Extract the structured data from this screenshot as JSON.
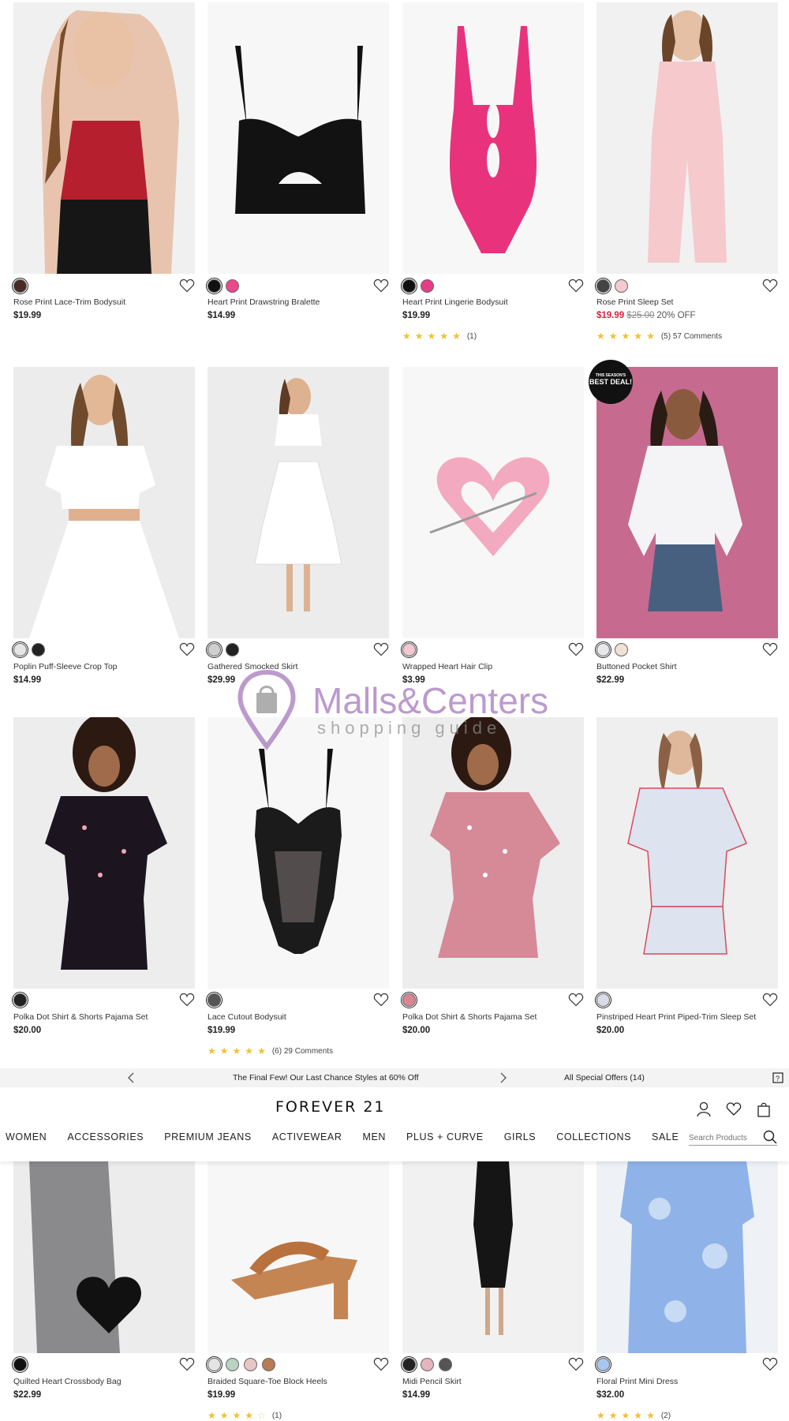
{
  "products": [
    {
      "name": "Rose Print Lace-Trim Bodysuit",
      "price": "$19.99",
      "swatches": [
        "#4a2a25"
      ],
      "img": "bodysuit-rose"
    },
    {
      "name": "Heart Print Drawstring Bralette",
      "price": "$14.99",
      "swatches": [
        "#111111",
        "#e9488a"
      ],
      "img": "bralette-black"
    },
    {
      "name": "Heart Print Lingerie Bodysuit",
      "price": "$19.99",
      "swatches": [
        "#111111",
        "#e63b86"
      ],
      "rating": "(1)",
      "stars": 5,
      "img": "bodysuit-pink"
    },
    {
      "name": "Rose Print Sleep Set",
      "price_sale": "$19.99",
      "price_orig": "$25.00",
      "price_off": "20% OFF",
      "swatches": [
        "#444444",
        "#f4c9cf"
      ],
      "rating": "(5) 57 Comments",
      "stars": 5,
      "img": "sleepset-rose"
    },
    {
      "name": "Poplin Puff-Sleeve Crop Top",
      "price": "$14.99",
      "swatches": [
        "#e5e5e5",
        "#222222"
      ],
      "img": "crop-white"
    },
    {
      "name": "Gathered Smocked Skirt",
      "price": "$29.99",
      "swatches": [
        "#cfcfcf",
        "#222222"
      ],
      "img": "skirt-white"
    },
    {
      "name": "Wrapped Heart Hair Clip",
      "price": "$3.99",
      "swatches": [
        "#f2c7cf"
      ],
      "img": "hairclip"
    },
    {
      "name": "Buttoned Pocket Shirt",
      "price": "$22.99",
      "swatches": [
        "#e8e8ec",
        "#efe1d4"
      ],
      "img": "shirt-white",
      "badge_top": "THIS SEASON'S",
      "badge_main": "BEST DEAL!"
    },
    {
      "name": "Polka Dot Shirt & Shorts Pajama Set",
      "price": "$20.00",
      "swatches": [
        "#222222"
      ],
      "img": "pj-black"
    },
    {
      "name": "Lace Cutout Bodysuit",
      "price": "$19.99",
      "swatches": [
        "#555555"
      ],
      "rating": "(6) 29 Comments",
      "stars": 4.5,
      "img": "lace-black"
    },
    {
      "name": "Polka Dot Shirt & Shorts Pajama Set",
      "price": "$20.00",
      "swatches": [
        "#d98592"
      ],
      "img": "pj-pink"
    },
    {
      "name": "Pinstriped Heart Print Piped-Trim Sleep Set",
      "price": "$20.00",
      "swatches": [
        "#d8dce6"
      ],
      "img": "pj-stripe"
    },
    {
      "name": "Quilted Heart Crossbody Bag",
      "price": "$22.99",
      "swatches": [
        "#111111"
      ],
      "img": "heartbag"
    },
    {
      "name": "Braided Square-Toe Block Heels",
      "price": "$19.99",
      "swatches": [
        "#e4e4e4",
        "#b9d2c2",
        "#e9c6c6",
        "#b97b55"
      ],
      "rating": "(1)",
      "stars": 4,
      "img": "heels"
    },
    {
      "name": "Midi Pencil Skirt",
      "price": "$14.99",
      "swatches": [
        "#222222",
        "#e4b5bd",
        "#555555"
      ],
      "img": "pencilskirt"
    },
    {
      "name": "Floral Print Mini Dress",
      "price": "$32.00",
      "swatches": [
        "#a9c7ee"
      ],
      "rating": "(2)",
      "stars": 4.5,
      "img": "floraldress"
    }
  ],
  "promo": {
    "text": "The Final Few! Our Last Chance Styles at 60% Off",
    "offers": "All Special Offers (14)"
  },
  "header": {
    "logo": "FOREVER 21",
    "menu": [
      "WOMEN",
      "ACCESSORIES",
      "PREMIUM JEANS",
      "ACTIVEWEAR",
      "MEN",
      "PLUS + CURVE",
      "GIRLS",
      "COLLECTIONS",
      "SALE"
    ],
    "search_placeholder": "Search Products"
  },
  "watermark": {
    "brand": "Malls&Centers",
    "tagline": "shopping guide"
  }
}
